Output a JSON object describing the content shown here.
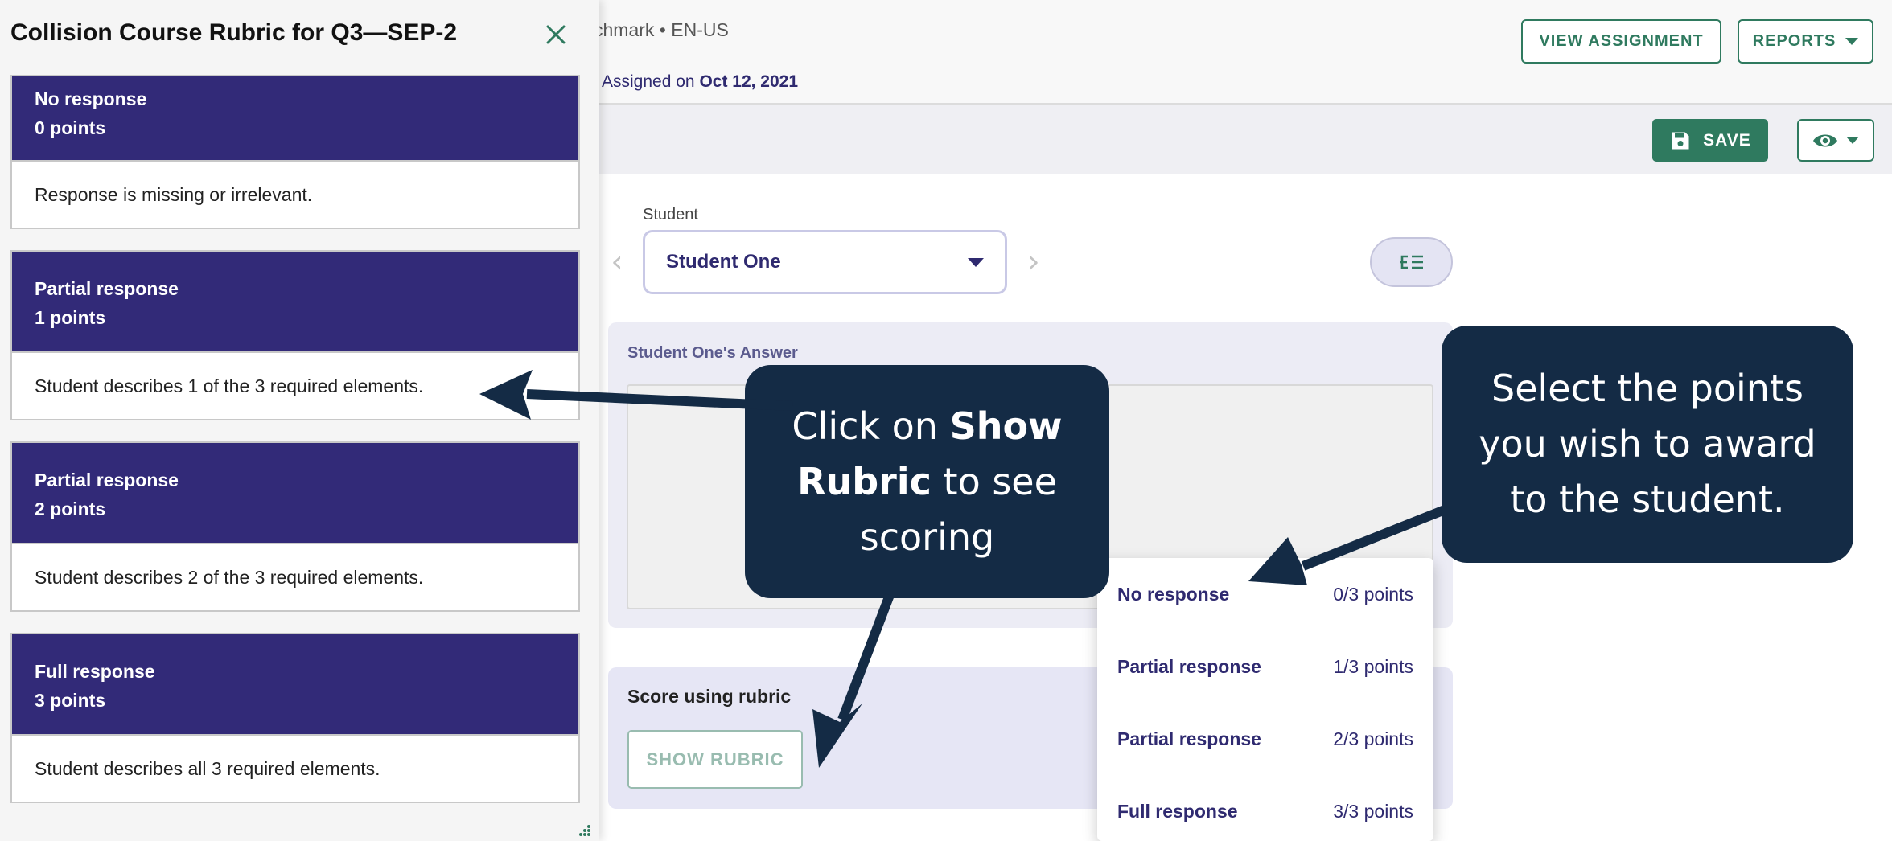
{
  "header": {
    "breadcrumb_partial": "chmark",
    "locale": "EN-US",
    "assigned_prefix": "Assigned on",
    "assigned_date": "Oct 12, 2021",
    "view_assignment_label": "VIEW ASSIGNMENT",
    "reports_label": "REPORTS"
  },
  "toolbar": {
    "save_label": "SAVE",
    "view_icon": "eye-icon"
  },
  "student": {
    "label": "Student",
    "selected": "Student One",
    "answer_label": "Student One's Answer"
  },
  "scoring": {
    "label": "Score using rubric",
    "show_rubric_label": "SHOW RUBRIC"
  },
  "points_menu": [
    {
      "name": "No response",
      "points": "0/3 points"
    },
    {
      "name": "Partial response",
      "points": "1/3 points"
    },
    {
      "name": "Partial response",
      "points": "2/3 points"
    },
    {
      "name": "Full response",
      "points": "3/3 points"
    }
  ],
  "drawer": {
    "title": "Collision Course Rubric for Q3—SEP-2",
    "close_icon": "close-icon",
    "items": [
      {
        "name": "No response",
        "points": "0 points",
        "description": "Response is missing or irrelevant."
      },
      {
        "name": "Partial response",
        "points": "1 points",
        "description": "Student describes 1 of the 3 required elements."
      },
      {
        "name": "Partial response",
        "points": "2 points",
        "description": "Student describes 2 of the 3 required elements."
      },
      {
        "name": "Full response",
        "points": "3 points",
        "description": "Student describes all 3 required elements."
      }
    ]
  },
  "callouts": {
    "show_rubric": {
      "pre": "Click on ",
      "bold": "Show Rubric",
      "post": " to see scoring"
    },
    "select_points": {
      "text": "Select the points you wish to award to the student."
    }
  },
  "colors": {
    "brand_green": "#2f7a5f",
    "rubric_header": "#322a78",
    "callout_bg": "#142b45",
    "text_purple": "#2f2a70"
  }
}
